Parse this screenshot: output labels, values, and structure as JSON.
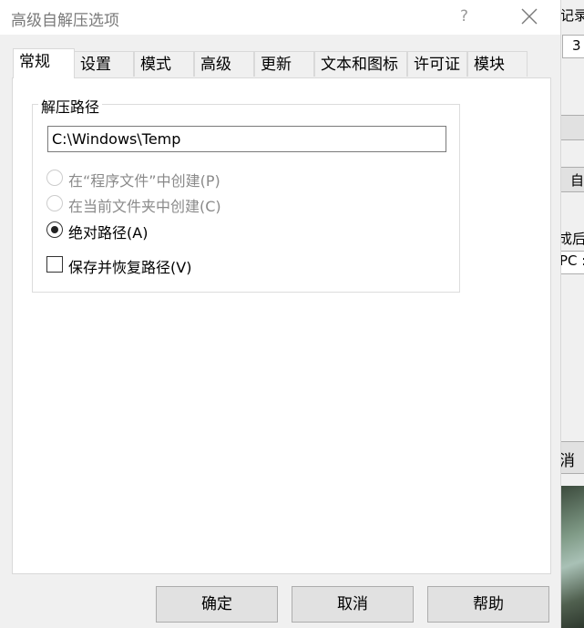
{
  "dialog": {
    "title": "高级自解压选项",
    "help_symbol": "?"
  },
  "tabs": [
    {
      "label": "常规",
      "active": true
    },
    {
      "label": "设置"
    },
    {
      "label": "模式"
    },
    {
      "label": "高级"
    },
    {
      "label": "更新"
    },
    {
      "label": "文本和图标"
    },
    {
      "label": "许可证"
    },
    {
      "label": "模块"
    }
  ],
  "general": {
    "group_label": "解压路径",
    "path_value": "C:\\Windows\\Temp",
    "radios": [
      {
        "label": "在“程序文件”中创建(P)",
        "enabled": false,
        "checked": false
      },
      {
        "label": "在当前文件夹中创建(C)",
        "enabled": false,
        "checked": false
      },
      {
        "label": "绝对路径(A)",
        "enabled": true,
        "checked": true
      }
    ],
    "save_restore_label": "保存并恢复路径(V)",
    "save_restore_checked": false
  },
  "buttons": {
    "ok": "确定",
    "cancel": "取消",
    "help": "帮助"
  },
  "background_window": {
    "fragments": [
      "记录",
      "3",
      "自",
      "成后(",
      "PC :",
      "消"
    ]
  }
}
